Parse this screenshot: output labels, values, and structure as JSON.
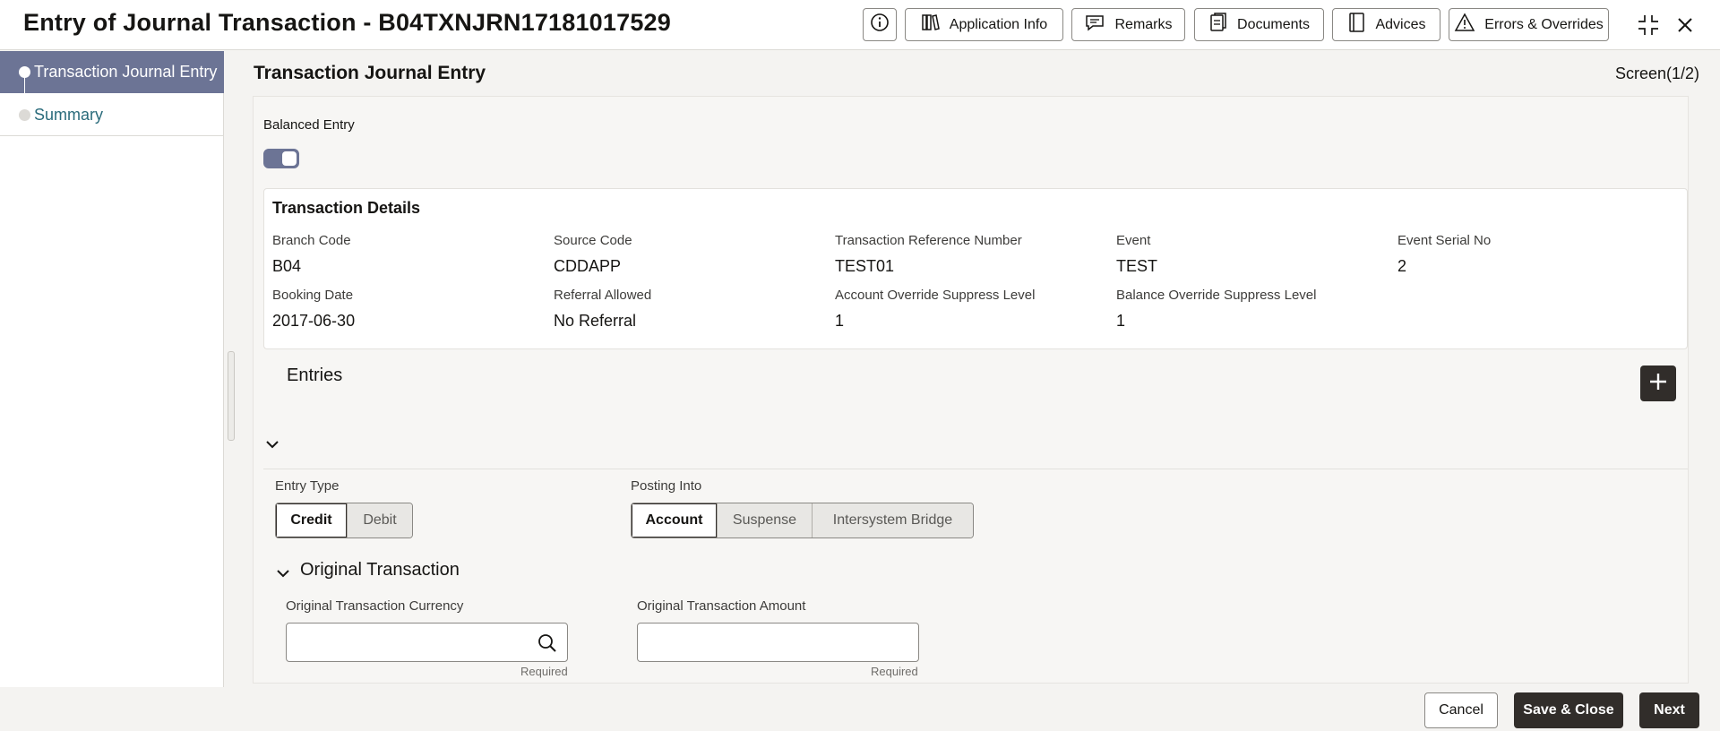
{
  "header": {
    "title": "Entry of Journal Transaction - B04TXNJRN17181017529",
    "buttons": {
      "application_info": "Application Info",
      "remarks": "Remarks",
      "documents": "Documents",
      "advices": "Advices",
      "errors_overrides": "Errors & Overrides"
    },
    "icons": [
      "info-icon",
      "book-icon",
      "chat-icon",
      "documents-icon",
      "advices-icon",
      "warning-icon",
      "collapse-icon",
      "close-icon"
    ]
  },
  "sidebar": {
    "steps": [
      {
        "label": "Transaction Journal Entry",
        "active": true
      },
      {
        "label": "Summary",
        "active": false
      }
    ]
  },
  "main": {
    "title": "Transaction Journal Entry",
    "screen_indicator": "Screen(1/2)",
    "balanced_entry": {
      "label": "Balanced Entry",
      "on": true
    },
    "transaction_details": {
      "title": "Transaction Details",
      "fields": [
        {
          "label": "Branch Code",
          "value": "B04"
        },
        {
          "label": "Source Code",
          "value": "CDDAPP"
        },
        {
          "label": "Transaction Reference Number",
          "value": "TEST01"
        },
        {
          "label": "Event",
          "value": "TEST"
        },
        {
          "label": "Event Serial No",
          "value": "2"
        },
        {
          "label": "Booking Date",
          "value": "2017-06-30"
        },
        {
          "label": "Referral Allowed",
          "value": "No Referral"
        },
        {
          "label": "Account Override Suppress Level",
          "value": "1"
        },
        {
          "label": "Balance Override Suppress Level",
          "value": "1"
        }
      ]
    },
    "entries": {
      "title": "Entries",
      "entry_type": {
        "label": "Entry Type",
        "options": [
          "Credit",
          "Debit"
        ],
        "selected": "Credit"
      },
      "posting_into": {
        "label": "Posting Into",
        "options": [
          "Account",
          "Suspense",
          "Intersystem Bridge"
        ],
        "selected": "Account"
      },
      "original_transaction": {
        "title": "Original Transaction",
        "currency": {
          "label": "Original Transaction Currency",
          "value": "",
          "hint": "Required"
        },
        "amount": {
          "label": "Original Transaction Amount",
          "value": "",
          "hint": "Required"
        }
      }
    }
  },
  "footer": {
    "cancel": "Cancel",
    "save_close": "Save & Close",
    "next": "Next"
  },
  "colors": {
    "accent": "#6c7495",
    "primary_button": "#312d2a",
    "link": "#2a6b7b"
  }
}
